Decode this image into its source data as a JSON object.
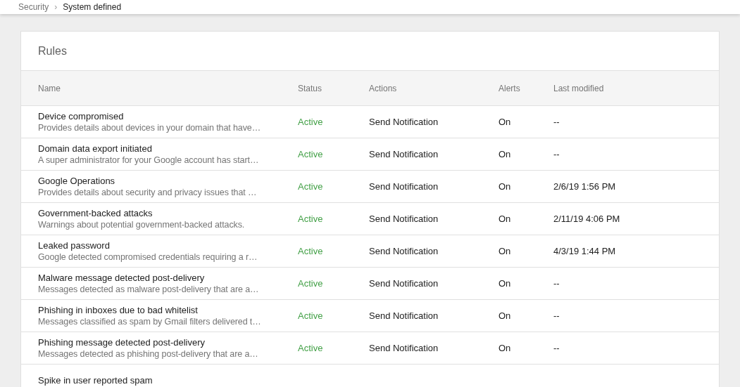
{
  "breadcrumb": [
    {
      "label": "Security",
      "selected": false
    },
    {
      "label": "System defined",
      "selected": true
    }
  ],
  "breadcrumb_separator": "›",
  "card": {
    "title": "Rules",
    "table": {
      "columns": [
        "Name",
        "Status",
        "Actions",
        "Alerts",
        "Last modified"
      ],
      "rows": [
        {
          "name": "Device compromised",
          "description": "Provides details about devices in your domain that have…",
          "status": "Active",
          "actions": "Send Notification",
          "alerts": "On",
          "last_modified": "--"
        },
        {
          "name": "Domain data export initiated",
          "description": "A super administrator for your Google account has start…",
          "status": "Active",
          "actions": "Send Notification",
          "alerts": "On",
          "last_modified": "--"
        },
        {
          "name": "Google Operations",
          "description": "Provides details about security and privacy issues that …",
          "status": "Active",
          "actions": "Send Notification",
          "alerts": "On",
          "last_modified": "2/6/19 1:56 PM"
        },
        {
          "name": "Government-backed attacks",
          "description": "Warnings about potential government-backed attacks.",
          "status": "Active",
          "actions": "Send Notification",
          "alerts": "On",
          "last_modified": "2/11/19 4:06 PM"
        },
        {
          "name": "Leaked password",
          "description": "Google detected compromised credentials requiring a r…",
          "status": "Active",
          "actions": "Send Notification",
          "alerts": "On",
          "last_modified": "4/3/19 1:44 PM"
        },
        {
          "name": "Malware message detected post-delivery",
          "description": "Messages detected as malware post-delivery that are a…",
          "status": "Active",
          "actions": "Send Notification",
          "alerts": "On",
          "last_modified": "--"
        },
        {
          "name": "Phishing in inboxes due to bad whitelist",
          "description": "Messages classified as spam by Gmail filters delivered t…",
          "status": "Active",
          "actions": "Send Notification",
          "alerts": "On",
          "last_modified": "--"
        },
        {
          "name": "Phishing message detected post-delivery",
          "description": "Messages detected as phishing post-delivery that are a…",
          "status": "Active",
          "actions": "Send Notification",
          "alerts": "On",
          "last_modified": "--"
        },
        {
          "name": "Spike in user reported spam"
        }
      ]
    }
  }
}
